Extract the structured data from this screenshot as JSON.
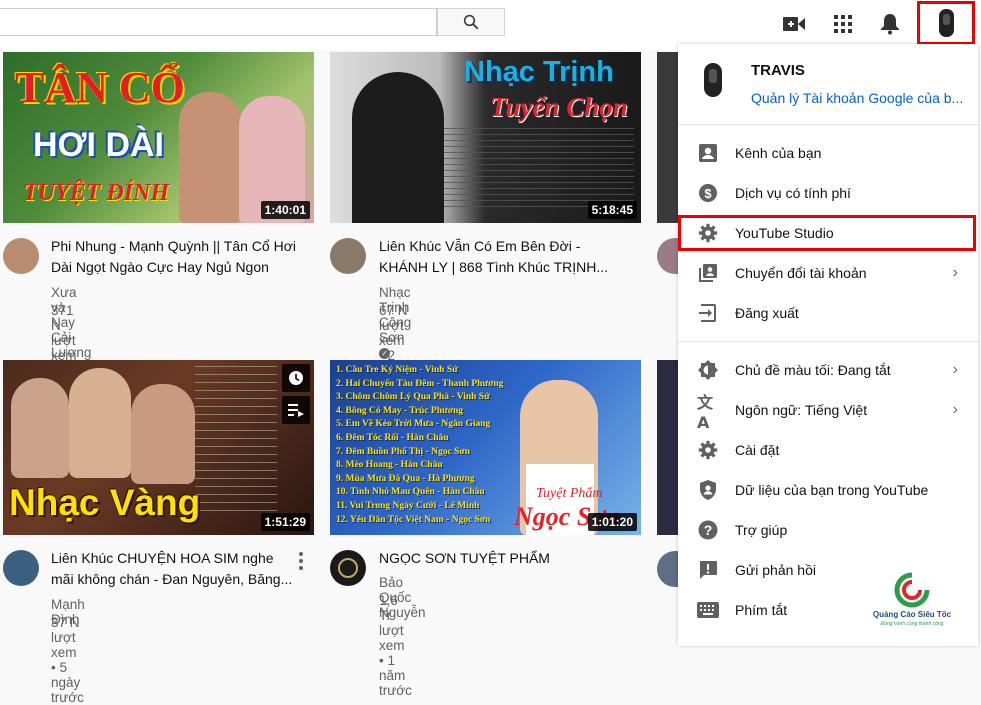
{
  "account": {
    "name": "TRAVIS",
    "manage_link": "Quản lý Tài khoản Google của b..."
  },
  "topbar": {
    "icons": [
      "search-icon",
      "video-add-icon",
      "apps-grid-icon",
      "bell-icon",
      "avatar"
    ]
  },
  "videos": [
    {
      "thumb_title": "TÂN CỔ",
      "thumb_line2": "HƠI DÀI",
      "thumb_line3": "TUYỆT ĐỈNH",
      "duration": "1:40:01",
      "title": "Phi Nhung - Mạnh Quỳnh || Tân Cổ Hơi Dài Ngọt Ngào Cực Hay Ngủ Ngon",
      "channel": "Xưa và Nay Cải Lương",
      "meta": "371 N lượt xem • 9 tháng trước"
    },
    {
      "thumb_title": "Nhạc Trịnh",
      "thumb_line2": "Tuyển Chọn",
      "duration": "5:18:45",
      "title": "Liên Khúc Vẫn Có Em Bên Đời - KHÁNH LY | 868 Tình Khúc TRỊNH...",
      "channel": "Nhạc Trịnh Công Sơn",
      "meta": "67 N lượt xem • 2 tuần trước"
    },
    {
      "thumb_title": "Nhạc Vàng",
      "duration": "1:51:29",
      "title": "Liên Khúc CHUYỆN HOA SIM nghe mãi không chán - Đan Nguyên, Băng...",
      "channel": "Mạnh Đình",
      "meta": "37 N lượt xem • 5 ngày trước"
    },
    {
      "thumb_list": [
        "1. Cầu Tre Kỷ Niệm - Vinh Sử",
        "2. Hai Chuyến Tàu Đêm - Thanh Phương",
        "3. Chôm Chôm Lý Qua Phà - Vinh Sử",
        "4. Bông Cỏ May - Trúc Phương",
        "5. Em Về Kẻo Trời Mưa - Ngân Giang",
        "6. Đêm Tóc Rối - Hàn Châu",
        "7. Đêm Buồn Phố Thị - Ngọc Sơn",
        "8. Mèo Hoang - Hàn Châu",
        "9. Mùa Mưa Đã Qua - Hà Phương",
        "10. Tình Nhỏ Mau Quên - Hàn Châu",
        "11. Vui Trong Ngày Cưới - Lê Minh",
        "12. Yêu Dân Tộc Việt Nam - Ngọc Sơn"
      ],
      "thumb_sig1": "Tuyệt Phẩm",
      "thumb_sig2": "Ngọc Sơn",
      "duration": "1:01:20",
      "title": "NGỌC SƠN TUYỆT PHẨM",
      "channel": "Bảo Quốc Nguyễn",
      "meta": "1,6 Tr lượt xem • 1 năm trước"
    }
  ],
  "menu": {
    "items": [
      {
        "icon": "person-box-icon",
        "label": "Kênh của bạn"
      },
      {
        "icon": "dollar-icon",
        "label": "Dịch vụ có tính phí"
      },
      {
        "icon": "gear-icon",
        "label": "YouTube Studio"
      },
      {
        "icon": "switch-account-icon",
        "label": "Chuyển đổi tài khoản"
      },
      {
        "icon": "sign-out-icon",
        "label": "Đăng xuất"
      },
      {
        "icon": "dark-theme-icon",
        "label": "Chủ đề màu tối: Đang tắt"
      },
      {
        "icon": "translate-icon",
        "label": "Ngôn ngữ: Tiếng Việt"
      },
      {
        "icon": "gear-icon",
        "label": "Cài đặt"
      },
      {
        "icon": "shield-person-icon",
        "label": "Dữ liệu của bạn trong YouTube"
      },
      {
        "icon": "help-icon",
        "label": "Trợ giúp"
      },
      {
        "icon": "feedback-icon",
        "label": "Gửi phản hồi"
      },
      {
        "icon": "keyboard-icon",
        "label": "Phím tắt"
      }
    ]
  },
  "watermark": {
    "title": "Quảng Cáo Siêu Tốc",
    "subtitle": "Đồng hành cùng thành công"
  },
  "colors": {
    "highlight": "#e00000",
    "link": "#065fd4"
  }
}
